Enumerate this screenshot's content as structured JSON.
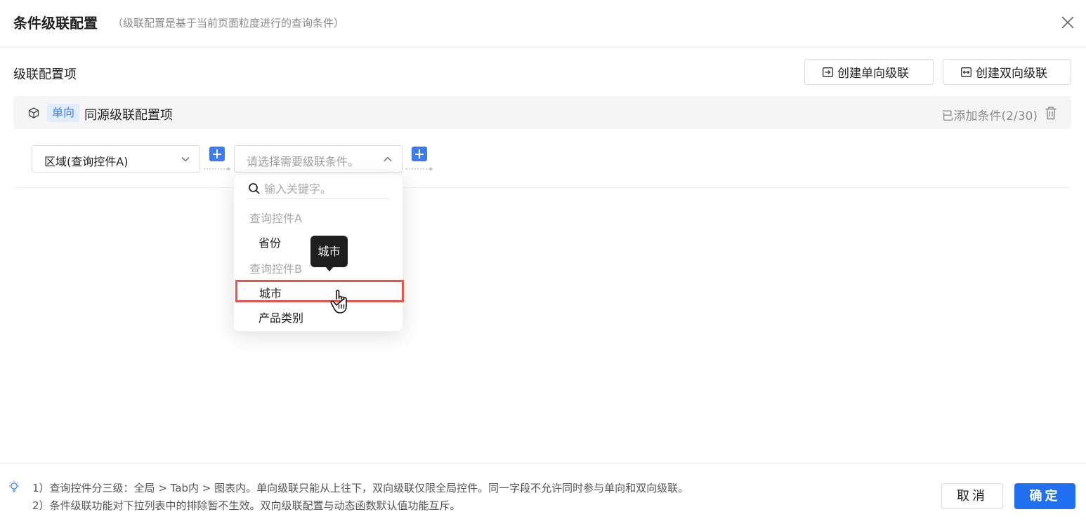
{
  "header": {
    "title": "条件级联配置",
    "subtitle": "（级联配置是基于当前页面粒度进行的查询条件）"
  },
  "section": {
    "title": "级联配置项",
    "create_unidirectional": "创建单向级联",
    "create_bidirectional": "创建双向级联"
  },
  "cascade_item": {
    "tag": "单向",
    "name": "同源级联配置项",
    "count_text": "已添加条件(2/30)"
  },
  "condition_row": {
    "select_a_value": "区域(查询控件A)",
    "select_b_placeholder": "请选择需要级联条件。"
  },
  "dropdown": {
    "search_placeholder": "输入关键字。",
    "groups": [
      {
        "label": "查询控件A",
        "options": [
          "省份"
        ]
      },
      {
        "label": "查询控件B",
        "options": [
          "城市",
          "产品类别"
        ]
      }
    ],
    "highlighted_option": "城市",
    "tooltip": "城市"
  },
  "footer": {
    "notes": [
      "1）查询控件分三级：全局 > Tab内 > 图表内。单向级联只能从上往下，双向级联仅限全局控件。同一字段不允许同时参与单向和双向级联。",
      "2）条件级联功能对下拉列表中的排除暂不生效。双向级联配置与动态函数默认值功能互斥。"
    ],
    "cancel_label": "取消",
    "ok_label": "确定"
  },
  "colors": {
    "primary": "#1f6ff0",
    "tag_bg": "#e1ecfd",
    "tag_text": "#3d7cf0",
    "highlight_border": "#e8534a"
  },
  "icons": [
    "close-icon",
    "enter-arrow-icon",
    "bidirectional-arrow-icon",
    "cube-icon",
    "trash-icon",
    "chevron-down-icon",
    "chevron-up-icon",
    "plus-icon",
    "search-icon",
    "hand-cursor-icon",
    "lightbulb-icon"
  ]
}
